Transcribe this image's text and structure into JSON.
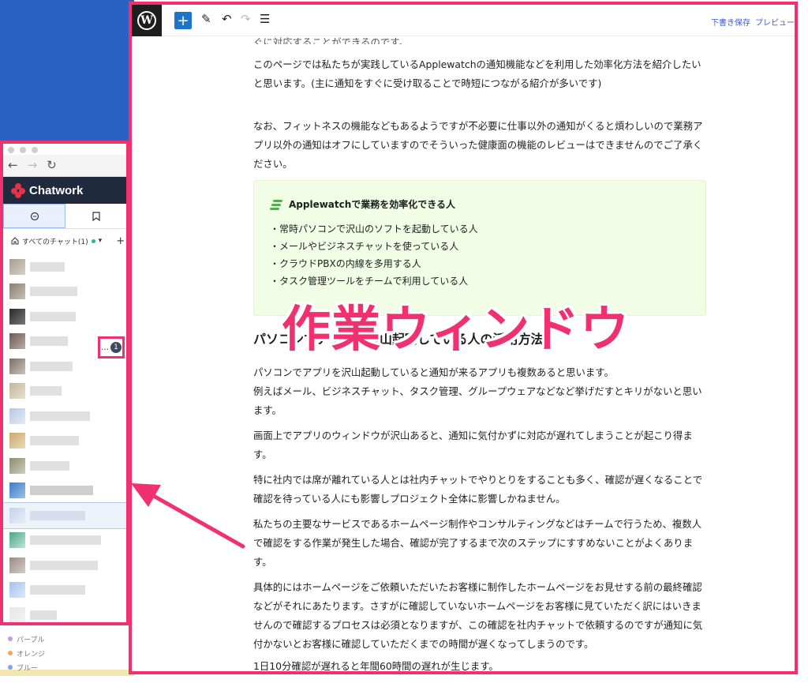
{
  "chatwork": {
    "logo_text": "Chatwork",
    "filter_label": "すべてのチャット(1)",
    "filter_caret": "▾",
    "filter_add": "+",
    "unread_count": "1",
    "unread_ellipsis": "…",
    "tags": [
      {
        "label": "パープル",
        "color": "#c39be0"
      },
      {
        "label": "オレンジ",
        "color": "#f2a45a"
      },
      {
        "label": "ブルー",
        "color": "#7aa6ea"
      }
    ]
  },
  "browser": {
    "back_icon": "←",
    "forward_icon": "→",
    "reload_icon": "↻"
  },
  "wp": {
    "logo": "W",
    "add_block_icon": "+",
    "edit_icon": "✎",
    "undo_icon": "↶",
    "redo_icon": "↷",
    "list_view_icon": "☰",
    "save_draft": "下書き保存",
    "preview": "プレビュー",
    "content": {
      "cut_line": "ぐに対応することができるのです。",
      "p1": "このページでは私たちが実践しているApplewatchの通知機能などを利用した効率化方法を紹介したいと思います。(主に通知をすぐに受け取ることで時短につながる紹介が多いです)",
      "p2": "なお、フィットネスの機能などもあるようですが不必要に仕事以外の通知がくると煩わしいので業務アプリ以外の通知はオフにしていますのでそういった健康面の機能のレビューはできませんのでご了承ください。",
      "box_title": "Applewatchで業務を効率化できる人",
      "box_items": [
        "・常時パソコンで沢山のソフトを起動している人",
        "・メールやビジネスチャットを使っている人",
        "・クラウドPBXの内線を多用する人",
        "・タスク管理ツールをチームで利用している人"
      ],
      "heading": "パソコンでアプリを沢山起動している人の活用方法",
      "p3a": "パソコンでアプリを沢山起動していると通知が来るアプリも複数あると思います。",
      "p3b": "例えばメール、ビジネスチャット、タスク管理、グループウェアなどなど挙げだすとキリがないと思います。",
      "p4": "画面上でアプリのウィンドウが沢山あると、通知に気付かずに対応が遅れてしまうことが起こり得ます。",
      "p5": "特に社内では席が離れている人とは社内チャットでやりとりをすることも多く、確認が遅くなることで確認を待っている人にも影響しプロジェクト全体に影響しかねません。",
      "p6": "私たちの主要なサービスであるホームページ制作やコンサルティングなどはチームで行うため、複数人で確認をする作業が発生した場合、確認が完了するまで次のステップにすすめないことがよくあります。",
      "p7": "具体的にはホームページをご依頼いただいたお客様に制作したホームページをお見せする前の最終確認などがそれにあたります。さすがに確認していないホームページをお客様に見ていただく訳にはいきませんので確認するプロセスは必須となりますが、この確認を社内チャットで依頼するのですが通知に気付かないとお客様に確認していただくまでの時間が遅くなってしまうのです。",
      "p8": "1日10分確認が遅れると年間60時間の遅れが生じます。"
    }
  },
  "overlay": {
    "label": "作業ウィンドウ",
    "color": "#f0306f"
  }
}
